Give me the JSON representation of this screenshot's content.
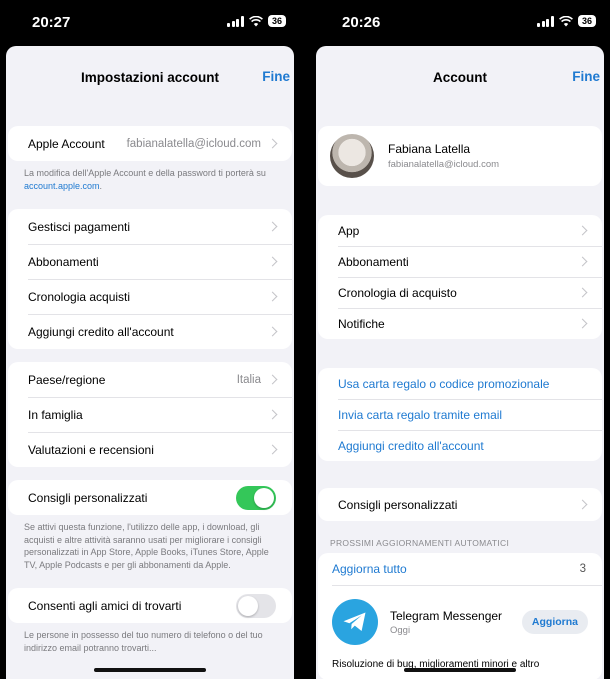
{
  "left": {
    "status": {
      "time": "20:27",
      "battery": "36"
    },
    "nav": {
      "title": "Impostazioni account",
      "done": "Fine"
    },
    "apple_account": {
      "label": "Apple Account",
      "value": "fabianalatella@icloud.com"
    },
    "apple_note": {
      "text": "La modifica dell'Apple Account e della password ti porterà su ",
      "link": "account.apple.com",
      "end": "."
    },
    "group1": [
      "Gestisci pagamenti",
      "Abbonamenti",
      "Cronologia acquisti",
      "Aggiungi credito all'account"
    ],
    "group2": [
      {
        "label": "Paese/regione",
        "value": "Italia"
      },
      {
        "label": "In famiglia",
        "value": ""
      },
      {
        "label": "Valutazioni e recensioni",
        "value": ""
      }
    ],
    "personalized": {
      "label": "Consigli personalizzati",
      "on": true
    },
    "personalized_note": "Se attivi questa funzione, l'utilizzo delle app, i download, gli acquisti e altre attività saranno usati per migliorare i consigli personalizzati in App Store, Apple Books, iTunes Store, Apple TV, Apple Podcasts e per gli abbonamenti da Apple.",
    "friends": {
      "label": "Consenti agli amici di trovarti",
      "on": false
    },
    "friends_note": "Le persone in possesso del tuo numero di telefono o del tuo indirizzo email potranno trovarti..."
  },
  "right": {
    "status": {
      "time": "20:26",
      "battery": "36"
    },
    "nav": {
      "title": "Account",
      "done": "Fine"
    },
    "profile": {
      "name": "Fabiana Latella",
      "email": "fabianalatella@icloud.com"
    },
    "group1": [
      "App",
      "Abbonamenti",
      "Cronologia di acquisto",
      "Notifiche"
    ],
    "links": [
      "Usa carta regalo o codice promozionale",
      "Invia carta regalo tramite email",
      "Aggiungi credito all'account"
    ],
    "personalized": "Consigli personalizzati",
    "updates_header": "PROSSIMI AGGIORNAMENTI AUTOMATICI",
    "update_all": {
      "label": "Aggiorna tutto",
      "count": "3"
    },
    "app": {
      "name": "Telegram Messenger",
      "sub": "Oggi",
      "button": "Aggiorna"
    },
    "release_note": "Risoluzione di bug, miglioramenti minori e altro"
  },
  "colors": {
    "accent": "#1f7ad1",
    "toggle_on": "#34c759",
    "background": "#f2f2f7"
  },
  "icons": [
    "signal-icon",
    "wifi-icon",
    "battery-icon",
    "chevron-right-icon",
    "telegram-icon"
  ]
}
